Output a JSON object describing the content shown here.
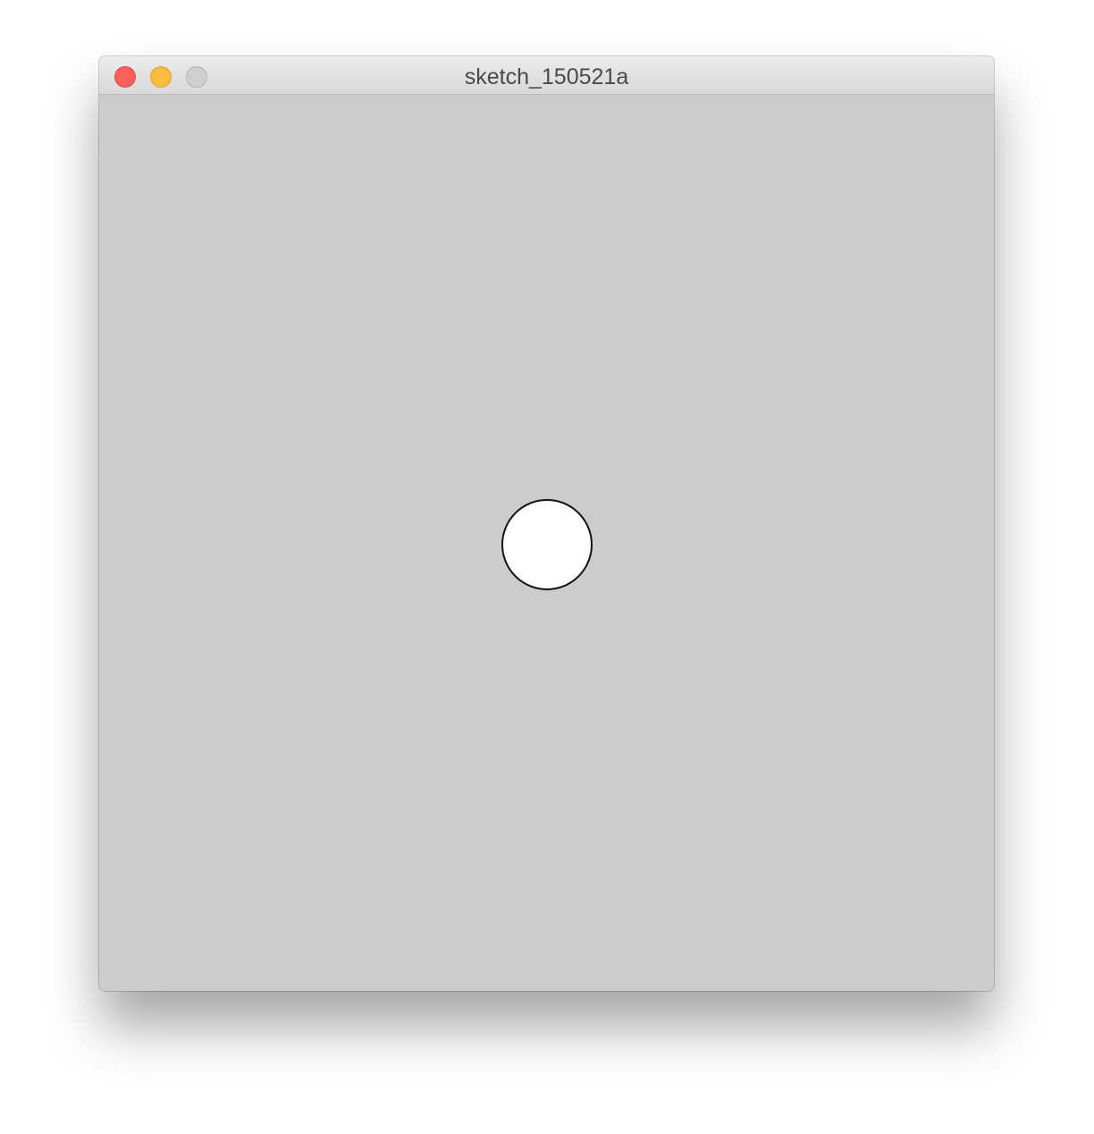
{
  "window": {
    "title": "sketch_150521a",
    "buttons": {
      "close": "close-icon",
      "minimize": "minimize-icon",
      "zoom": "zoom-icon"
    }
  },
  "colors": {
    "canvas_background": "#cccccc",
    "circle_fill": "#ffffff",
    "circle_stroke": "#111111",
    "close": "#fc605b",
    "minimize": "#fdbc40",
    "zoom_inactive": "#cfcfcf"
  }
}
